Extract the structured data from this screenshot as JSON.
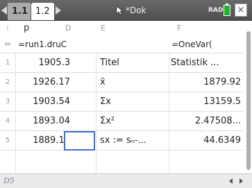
{
  "tabs": [
    {
      "label": "1.1"
    },
    {
      "label": "1.2"
    }
  ],
  "document": {
    "title": "*Dok",
    "mode": "RAD"
  },
  "columns": {
    "p": {
      "name": "p",
      "letter": "D"
    },
    "e": {
      "letter": "E"
    },
    "f": {
      "letter": "F"
    }
  },
  "formula_row": {
    "marker": "=",
    "p": "=run1.druС",
    "f": "=OneVar("
  },
  "rows": [
    {
      "num": "1",
      "p": "1905.3",
      "e": "Titel",
      "f": "Statistik ..."
    },
    {
      "num": "2",
      "p": "1926.17",
      "e": "x̄",
      "f": "1879.92"
    },
    {
      "num": "3",
      "p": "1903.54",
      "e": "Σx",
      "f": "13159.5"
    },
    {
      "num": "4",
      "p": "1893.04",
      "e": "Σx²",
      "f": "2.47508..."
    },
    {
      "num": "5",
      "p": "1889.14",
      "e": "sx := sₙ-...",
      "f": "44.6349"
    }
  ],
  "status": {
    "cell_ref": "D5"
  },
  "colors": {
    "accent": "#3a6fd1",
    "battery": "#1fb52a"
  }
}
